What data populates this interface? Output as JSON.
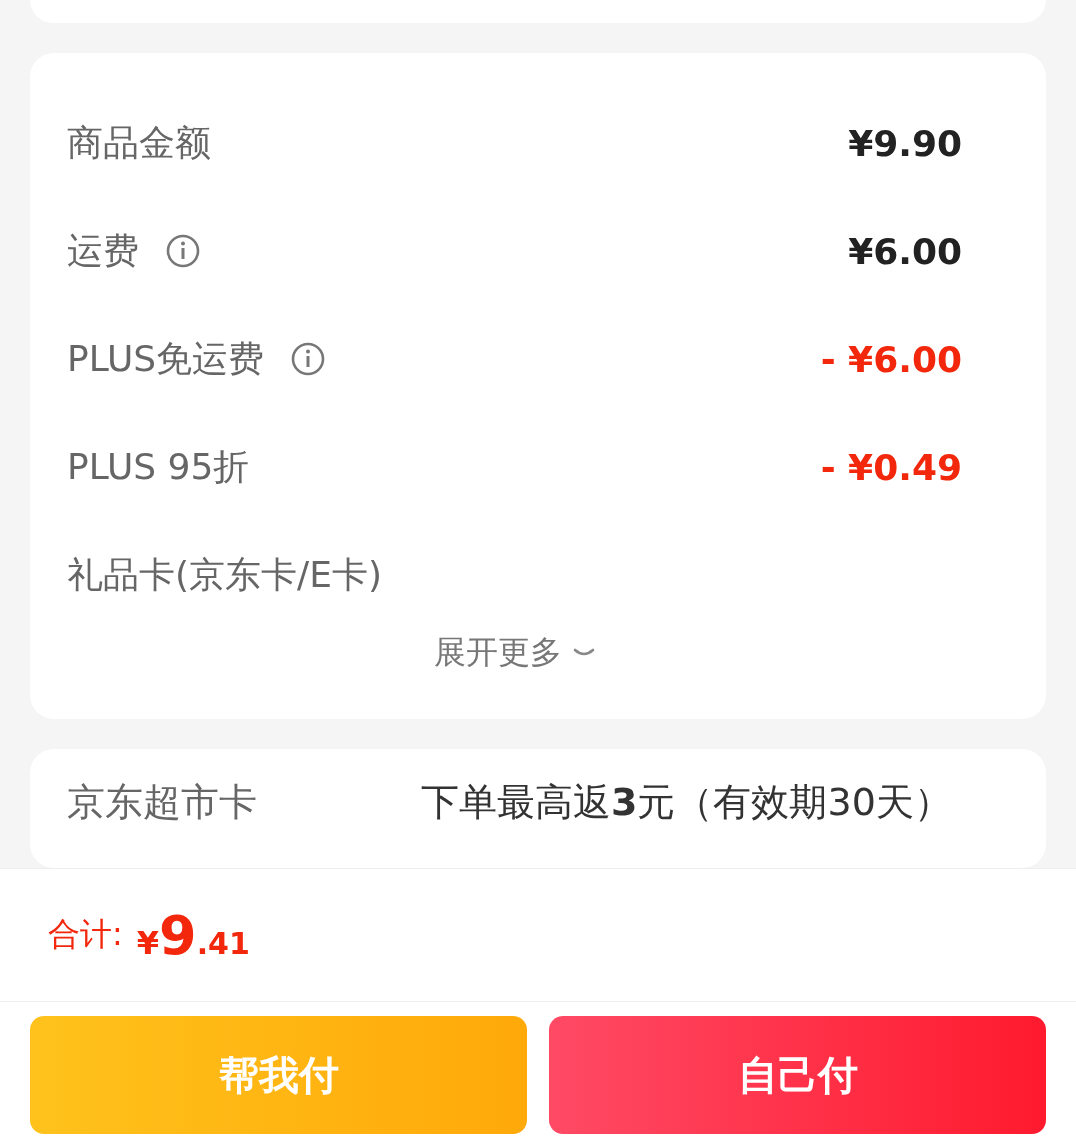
{
  "summary": {
    "rows": [
      {
        "label": "商品金额",
        "info": false,
        "value": "¥9.90",
        "kind": "amount"
      },
      {
        "label": "运费",
        "info": true,
        "value": "¥6.00",
        "kind": "amount"
      },
      {
        "label": "PLUS免运费",
        "info": true,
        "value": "- ¥6.00",
        "kind": "discount"
      },
      {
        "label": "PLUS 95折",
        "info": false,
        "value": "- ¥0.49",
        "kind": "discount"
      },
      {
        "label": "礼品卡(京东卡/E卡)",
        "info": false
      }
    ],
    "expand": "展开更多"
  },
  "card": {
    "label": "京东超市卡",
    "text": "下单最高返**3**元（有效期30天）"
  },
  "total": {
    "label": "合计:",
    "currency": "¥",
    "integer": "9",
    "decimal": ".41"
  },
  "buttons": [
    {
      "label": "帮我付",
      "kind": "help"
    },
    {
      "label": "自己付",
      "kind": "self"
    }
  ]
}
